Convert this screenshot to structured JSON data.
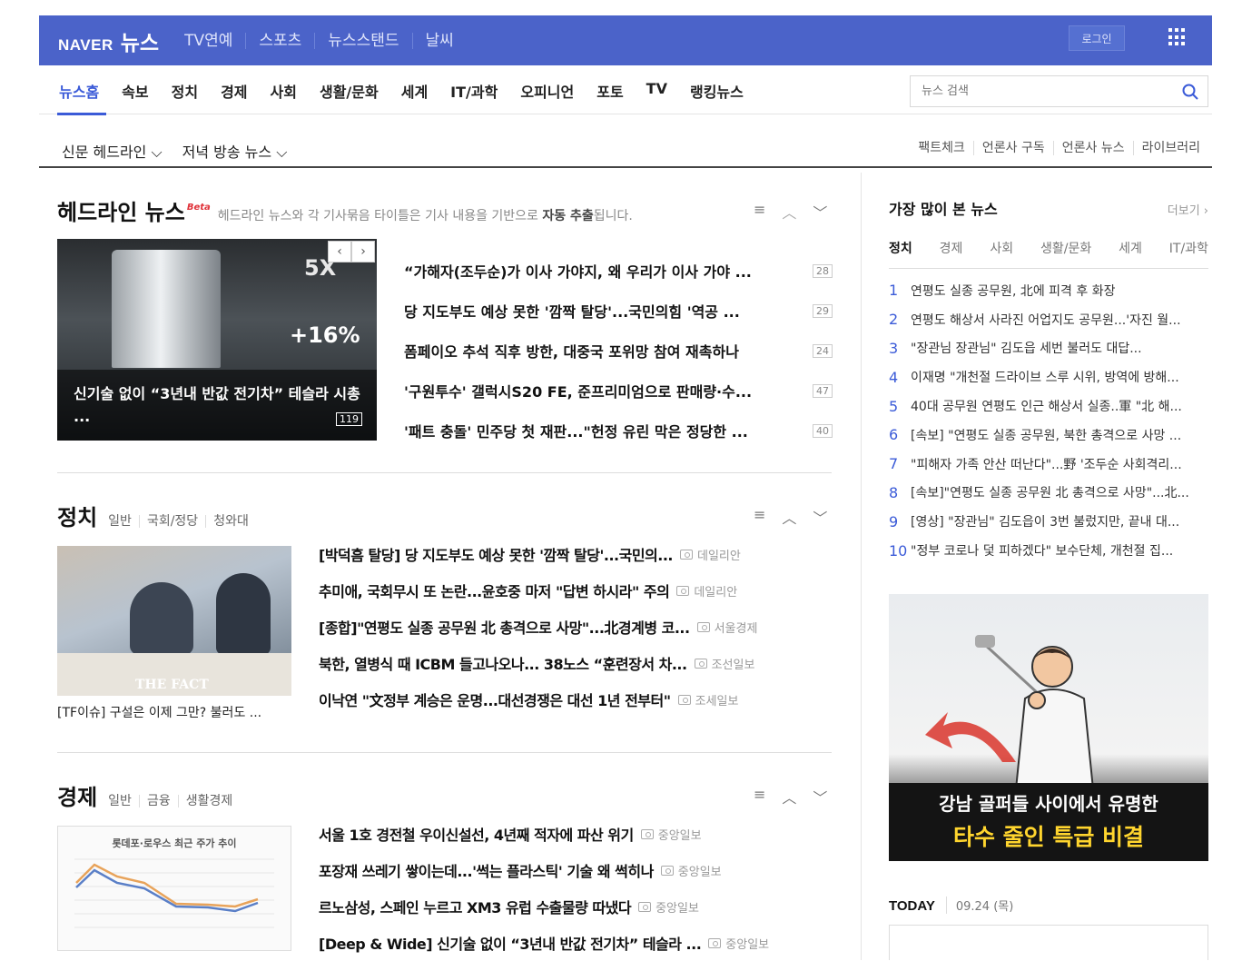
{
  "topbar": {
    "logo_naver": "NAVER",
    "logo_news": "뉴스",
    "nav": [
      "TV연예",
      "스포츠",
      "뉴스스탠드",
      "날씨"
    ],
    "login": "로그인"
  },
  "mainnav": {
    "items": [
      "뉴스홈",
      "속보",
      "정치",
      "경제",
      "사회",
      "생활/문화",
      "세계",
      "IT/과학",
      "오피니언",
      "포토",
      "TV",
      "랭킹뉴스"
    ],
    "search_placeholder": "뉴스 검색"
  },
  "subnav": {
    "left": [
      "신문 헤드라인 ⌵",
      "저녁 방송 뉴스 ⌵"
    ],
    "right": [
      "팩트체크",
      "언론사 구독",
      "언론사 뉴스",
      "라이브러리"
    ]
  },
  "headline": {
    "title": "헤드라인 뉴스",
    "beta": "Beta",
    "desc_pre": "헤드라인 뉴스와 각 기사묶음 타이틀은 기사 내용을 기반으로 ",
    "desc_bold": "자동 추출",
    "desc_post": "됩니다.",
    "image_caption": "신기술 없이 “3년내 반값 전기차” 테슬라 시총 ...",
    "image_count": "119",
    "image_text_5x": "5X",
    "image_text_pct": "+16%",
    "items": [
      {
        "title": "“가해자(조두순)가 이사 가야지, 왜 우리가 이사 가야 ...",
        "count": "28"
      },
      {
        "title": "당 지도부도 예상 못한 '깜짝 탈당'...국민의힘 '역공 ...",
        "count": "29"
      },
      {
        "title": "폼페이오 추석 직후 방한, 대중국 포위망 참여 재촉하나",
        "count": "24"
      },
      {
        "title": "'구원투수' 갤럭시S20 FE, 준프리미엄으로 판매량·수...",
        "count": "47"
      },
      {
        "title": "'패트 충돌' 민주당 첫 재판...\"헌정 유린 막은 정당한 ...",
        "count": "40"
      }
    ]
  },
  "politics": {
    "title": "정치",
    "cats": [
      "일반",
      "국회/정당",
      "청와대"
    ],
    "image_caption": "[TF이슈] 구설은 이제 그만? 불러도 ...",
    "image_watermark": "THE FACT",
    "items": [
      {
        "title": "[박덕흠 탈당] 당 지도부도 예상 못한 '깜짝 탈당'...국민의...",
        "press": "데일리안"
      },
      {
        "title": "추미애, 국회무시 또 논란...윤호중 마저 \"답변 하시라\" 주의",
        "press": "데일리안"
      },
      {
        "title": "[종합]\"연평도 실종 공무원 北 총격으로 사망\"...北경계병 코...",
        "press": "서울경제"
      },
      {
        "title": "북한, 열병식 때 ICBM 들고나오나... 38노스 “훈련장서 차...",
        "press": "조선일보"
      },
      {
        "title": "이낙연 \"文정부 계승은 운명...대선경쟁은 대선 1년 전부터\"",
        "press": "조세일보"
      }
    ]
  },
  "economy": {
    "title": "경제",
    "cats": [
      "일반",
      "금융",
      "생활경제"
    ],
    "chart_title": "롯데포·로우스 최근 주가 추이",
    "items": [
      {
        "title": "서울 1호 경전철 우이신설선, 4년째 적자에 파산 위기",
        "press": "중앙일보"
      },
      {
        "title": "포장재 쓰레기 쌓이는데...'썩는 플라스틱' 기술 왜 썩히나",
        "press": "중앙일보"
      },
      {
        "title": "르노삼성, 스페인 누르고 XM3 유럽 수출물량 따냈다",
        "press": "중앙일보"
      },
      {
        "title": "[Deep & Wide] 신기술 없이 “3년내 반값 전기차” 테슬라 ...",
        "press": "중앙일보"
      }
    ]
  },
  "mostread": {
    "title": "가장 많이 본 뉴스",
    "more": "더보기 ›",
    "tabs": [
      "정치",
      "경제",
      "사회",
      "생활/문화",
      "세계",
      "IT/과학"
    ],
    "items": [
      {
        "n": "1",
        "t": "연평도 실종 공무원, 北에 피격 후 화장"
      },
      {
        "n": "2",
        "t": "연평도 해상서 사라진 어업지도 공무원...'자진 월..."
      },
      {
        "n": "3",
        "t": "\"장관님 장관님\" 김도읍 세번 불러도 대답..."
      },
      {
        "n": "4",
        "t": "이재명 \"개천절 드라이브 스루 시위, 방역에 방해..."
      },
      {
        "n": "5",
        "t": "40대 공무원 연평도 인근 해상서 실종..軍 \"北 해..."
      },
      {
        "n": "6",
        "t": "[속보] \"연평도 실종 공무원, 북한 총격으로 사망 ..."
      },
      {
        "n": "7",
        "t": "\"피해자 가족 안산 떠난다\"...野 '조두순 사회격리..."
      },
      {
        "n": "8",
        "t": "[속보]\"연평도 실종 공무원 北 총격으로 사망\"...北..."
      },
      {
        "n": "9",
        "t": "[영상] \"장관님\" 김도읍이 3번 불렀지만, 끝내 대..."
      },
      {
        "n": "10",
        "t": "\"정부 코로나 덫 피하겠다\" 보수단체, 개천절 집..."
      }
    ]
  },
  "ad": {
    "line1": "강남 골퍼들 사이에서 유명한",
    "line2": "타수 줄인 특급 비결"
  },
  "today": {
    "label": "TODAY",
    "date": "09.24 (목)"
  },
  "colors": {
    "brand": "#4b63c9",
    "accent": "#3b5bd8"
  }
}
